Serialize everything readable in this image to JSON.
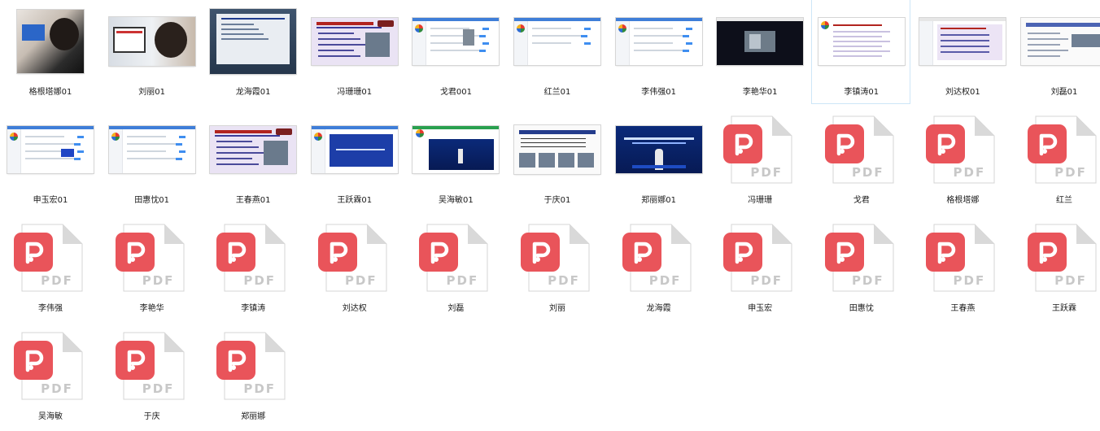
{
  "files": [
    {
      "name": "格根塔娜01",
      "kind": "image",
      "thumb": "photo-dark"
    },
    {
      "name": "刘丽01",
      "kind": "image",
      "thumb": "photo-room"
    },
    {
      "name": "龙海霞01",
      "kind": "image",
      "thumb": "projector"
    },
    {
      "name": "冯珊珊01",
      "kind": "image",
      "thumb": "slide"
    },
    {
      "name": "戈君001",
      "kind": "image",
      "thumb": "web-a"
    },
    {
      "name": "红兰01",
      "kind": "image",
      "thumb": "web-b"
    },
    {
      "name": "李伟强01",
      "kind": "image",
      "thumb": "web-c"
    },
    {
      "name": "李艳华01",
      "kind": "image",
      "thumb": "video"
    },
    {
      "name": "李镇涛01",
      "kind": "image",
      "thumb": "slide-white",
      "selected": true
    },
    {
      "name": "刘达权01",
      "kind": "image",
      "thumb": "web-slide"
    },
    {
      "name": "刘磊01",
      "kind": "image",
      "thumb": "doc"
    },
    {
      "name": "申玉宏01",
      "kind": "image",
      "thumb": "web-d"
    },
    {
      "name": "田惠忱01",
      "kind": "image",
      "thumb": "web-e"
    },
    {
      "name": "王春燕01",
      "kind": "image",
      "thumb": "slide"
    },
    {
      "name": "王跃霖01",
      "kind": "image",
      "thumb": "web-f"
    },
    {
      "name": "吴海敏01",
      "kind": "image",
      "thumb": "stage-web"
    },
    {
      "name": "于庆01",
      "kind": "image",
      "thumb": "doc-photos"
    },
    {
      "name": "郑丽娜01",
      "kind": "image",
      "thumb": "stage"
    },
    {
      "name": "冯珊珊",
      "kind": "pdf"
    },
    {
      "name": "戈君",
      "kind": "pdf"
    },
    {
      "name": "格根塔娜",
      "kind": "pdf"
    },
    {
      "name": "红兰",
      "kind": "pdf"
    },
    {
      "name": "李伟强",
      "kind": "pdf"
    },
    {
      "name": "李艳华",
      "kind": "pdf"
    },
    {
      "name": "李镇涛",
      "kind": "pdf"
    },
    {
      "name": "刘达权",
      "kind": "pdf"
    },
    {
      "name": "刘磊",
      "kind": "pdf"
    },
    {
      "name": "刘丽",
      "kind": "pdf"
    },
    {
      "name": "龙海霞",
      "kind": "pdf"
    },
    {
      "name": "申玉宏",
      "kind": "pdf"
    },
    {
      "name": "田惠忱",
      "kind": "pdf"
    },
    {
      "name": "王春燕",
      "kind": "pdf"
    },
    {
      "name": "王跃霖",
      "kind": "pdf"
    },
    {
      "name": "吴海敏",
      "kind": "pdf"
    },
    {
      "name": "于庆",
      "kind": "pdf"
    },
    {
      "name": "郑丽娜",
      "kind": "pdf"
    }
  ],
  "pdf_icon": {
    "text": "PDF",
    "accent": "#e9545a",
    "page": "#ffffff",
    "fold": "#d9d9d9",
    "text_color": "#c8c8c8"
  },
  "selection_border": "#cde6f7"
}
